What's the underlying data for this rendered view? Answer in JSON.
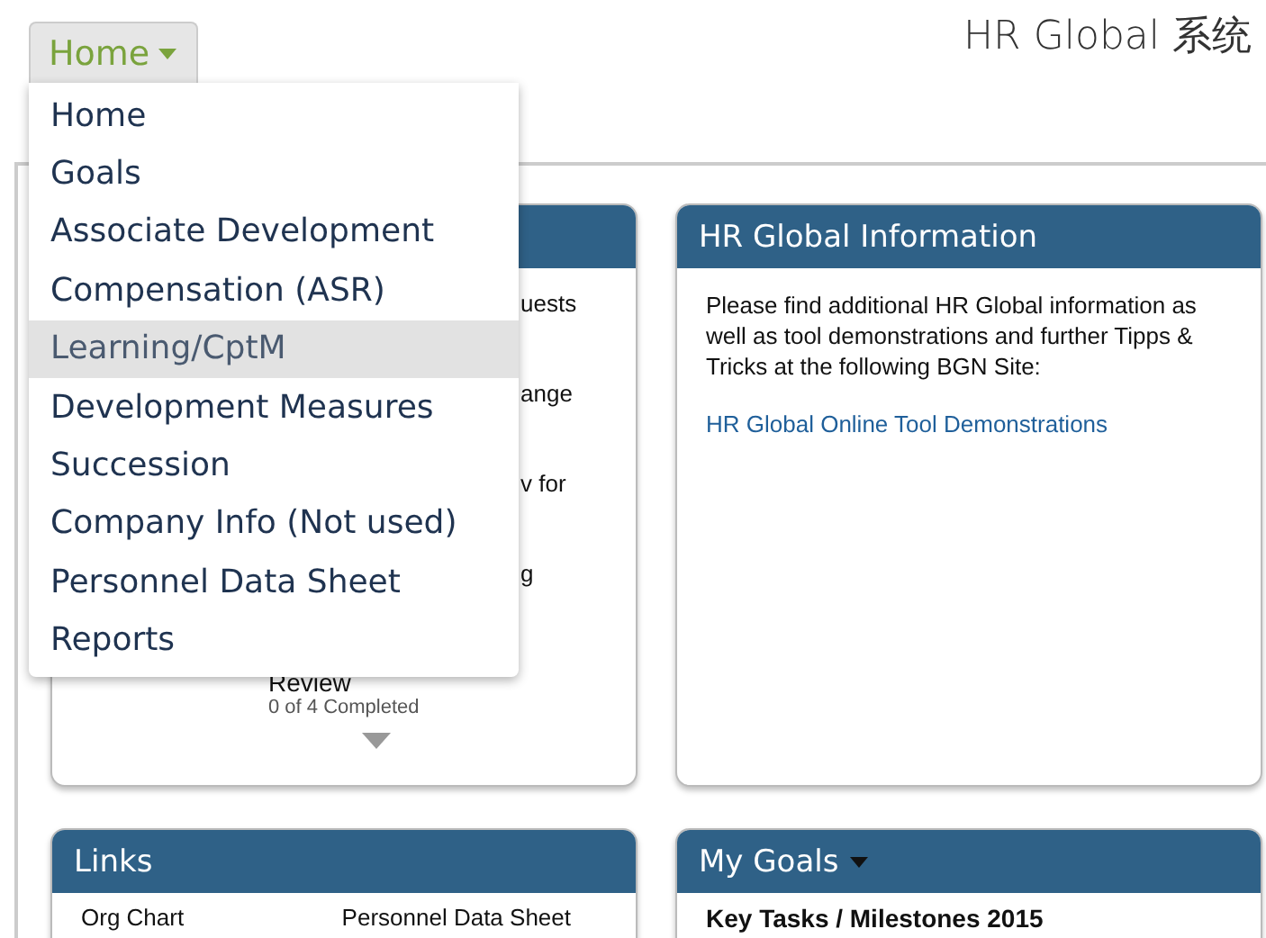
{
  "app_title": "HR Global 系统",
  "nav_button": {
    "label": "Home"
  },
  "menu": [
    {
      "label": "Home",
      "selected": false
    },
    {
      "label": "Goals",
      "selected": false
    },
    {
      "label": "Associate Development",
      "selected": false
    },
    {
      "label": "Compensation (ASR)",
      "selected": false
    },
    {
      "label": "Learning/CptM",
      "selected": true
    },
    {
      "label": "Development Measures",
      "selected": false
    },
    {
      "label": "Succession",
      "selected": false
    },
    {
      "label": "Company Info (Not used)",
      "selected": false
    },
    {
      "label": "Personnel Data Sheet",
      "selected": false
    },
    {
      "label": "Reports",
      "selected": false
    }
  ],
  "tasks_card": {
    "fragments": [
      "uests",
      "ange",
      "v for",
      "g"
    ],
    "task": {
      "title": "Review",
      "progress": "0 of 4 Completed"
    }
  },
  "info_card": {
    "title": "HR Global Information",
    "text": "Please find additional HR Global information as well as tool demonstrations and further Tipps & Tricks at the following BGN Site:",
    "link": "HR Global Online Tool Demonstrations"
  },
  "links_card": {
    "title": "Links",
    "links": [
      "Org Chart",
      "Personnel Data Sheet"
    ]
  },
  "goals_card": {
    "title": "My Goals",
    "heading": "Key Tasks / Milestones 2015"
  }
}
